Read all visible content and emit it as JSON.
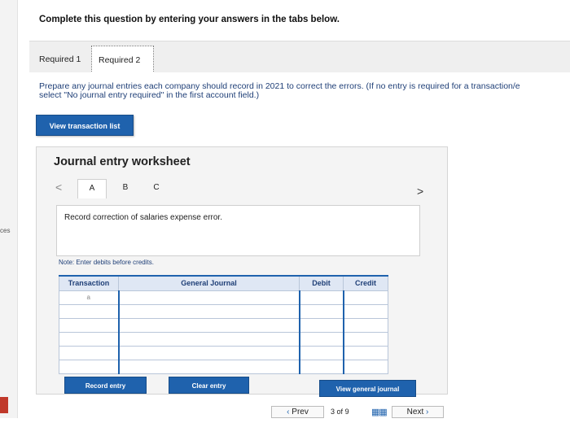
{
  "instruction": "Complete this question by entering your answers in the tabs below.",
  "tabs": [
    {
      "label": "Required 1"
    },
    {
      "label": "Required 2"
    }
  ],
  "prompt_line1": "Prepare any journal entries each company should record in 2021 to correct the errors. (If no entry is required for a transaction/e",
  "prompt_line2": "select \"No journal entry required\" in the first account field.)",
  "view_transaction_list": "View transaction list",
  "worksheet": {
    "title": "Journal entry worksheet",
    "prev_glyph": "<",
    "next_glyph": ">",
    "tabs": [
      "A",
      "B",
      "C"
    ],
    "description": "Record correction of salaries expense error.",
    "note": "Note: Enter debits before credits.",
    "table": {
      "headers": [
        "Transaction",
        "General Journal",
        "Debit",
        "Credit"
      ],
      "rows": [
        [
          "a",
          "",
          "",
          ""
        ],
        [
          "",
          "",
          "",
          ""
        ],
        [
          "",
          "",
          "",
          ""
        ],
        [
          "",
          "",
          "",
          ""
        ],
        [
          "",
          "",
          "",
          ""
        ],
        [
          "",
          "",
          "",
          ""
        ]
      ]
    },
    "buttons": {
      "record": "Record entry",
      "clear": "Clear entry",
      "view_gj": "View general journal"
    }
  },
  "nav": {
    "prev": "Prev",
    "page_current": "3",
    "page_sep": "of",
    "page_total": "9",
    "next": "Next"
  },
  "left_strip_label": "ces",
  "colors": {
    "accent": "#1f62ad",
    "prompt_text": "#1f3f77",
    "header_bg": "#dfe7f4"
  }
}
